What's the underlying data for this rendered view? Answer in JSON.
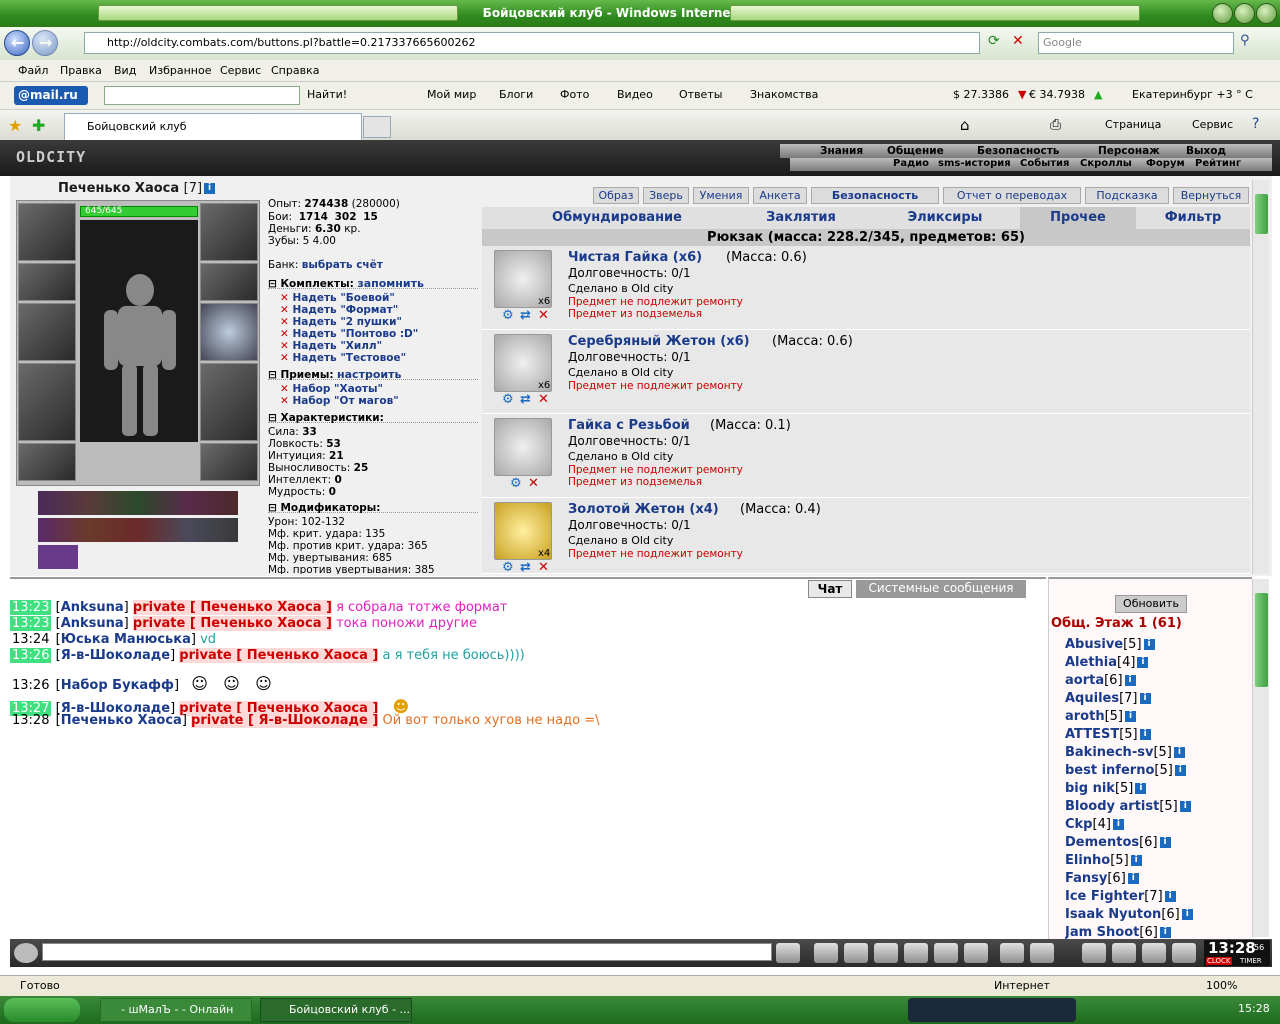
{
  "window": {
    "title": "Бойцовский клуб - Windows Internet Explorer",
    "url": "http://oldcity.combats.com/buttons.pl?battle=0.217337665600262",
    "search_placeholder": "Google"
  },
  "menu": [
    "Файл",
    "Правка",
    "Вид",
    "Избранное",
    "Сервис",
    "Справка"
  ],
  "mailbar": {
    "logo": "@mail.ru",
    "find": "Найти!",
    "links": [
      "Мой мир",
      "Блоги",
      "Фото",
      "Видео",
      "Ответы",
      "Знакомства"
    ],
    "usd": "$ 27.3386",
    "eur": "€ 34.7938",
    "weather": "Екатеринбург +3 ° C"
  },
  "tab": {
    "title": "Бойцовский клуб",
    "page": "Страница",
    "service": "Сервис"
  },
  "game_nav": {
    "logo": "OLDCITY",
    "row1": [
      "Знания",
      "Общение",
      "Безопасность",
      "Персонаж",
      "Выход"
    ],
    "row2": [
      "Радио",
      "sms-история",
      "События",
      "Скроллы",
      "Форум",
      "Рейтинг"
    ]
  },
  "character": {
    "name": "Печенько Хаоса",
    "level": "[7]",
    "hp": "645/645",
    "exp_label": "Опыт:",
    "exp": "274438",
    "exp_next": "(280000)",
    "fights_label": "Бои:",
    "fights_win": "1714",
    "fights_lose": "302",
    "fights_draw": "15",
    "money_label": "Деньги:",
    "money": "6.30",
    "money_unit": "кр.",
    "teeth_label": "Зубы:",
    "teeth": "5 4.00",
    "bank_label": "Банк:",
    "bank_link": "выбрать счёт"
  },
  "kits": {
    "title": "Комплекты:",
    "remember": "запомнить",
    "items": [
      "Надеть \"Боевой\"",
      "Надеть \"Формат\"",
      "Надеть \"2 пушки\"",
      "Надеть \"Понтово :D\"",
      "Надеть \"Хилл\"",
      "Надеть \"Тестовое\""
    ]
  },
  "techniques": {
    "title": "Приемы:",
    "setup": "настроить",
    "items": [
      "Набор \"Хаоты\"",
      "Набор \"От магов\""
    ]
  },
  "stats": {
    "title": "Характеристики:",
    "items": [
      {
        "label": "Сила:",
        "value": "33"
      },
      {
        "label": "Ловкость:",
        "value": "53"
      },
      {
        "label": "Интуиция:",
        "value": "21"
      },
      {
        "label": "Выносливость:",
        "value": "25"
      },
      {
        "label": "Интеллект:",
        "value": "0"
      },
      {
        "label": "Мудрость:",
        "value": "0"
      }
    ]
  },
  "modifiers": {
    "title": "Модификаторы:",
    "items": [
      "Урон: 102-132",
      "Мф. крит. удара: 135",
      "Мф. против крит. удара: 365",
      "Мф. увертывания: 685",
      "Мф. против увертывания: 385"
    ]
  },
  "top_tabs": [
    "Образ",
    "Зверь",
    "Умения",
    "Анкета",
    "Безопасность",
    "Отчет о переводах",
    "Подсказка",
    "Вернуться"
  ],
  "categories": [
    "Обмундирование",
    "Заклятия",
    "Эликсиры",
    "Прочее",
    "Фильтр"
  ],
  "backpack": "Рюкзак (масса: 228.2/345, предметов: 65)",
  "items": [
    {
      "name": "Чистая Гайка (x6)",
      "mass": "(Масса: 0.6)",
      "durability": "Долговечность: 0/1",
      "made": "Сделано в Old city",
      "notes": [
        "Предмет не подлежит ремонту",
        "Предмет из подземелья"
      ],
      "count": "x6"
    },
    {
      "name": "Серебряный Жетон (x6)",
      "mass": "(Масса: 0.6)",
      "durability": "Долговечность: 0/1",
      "made": "Сделано в Old city",
      "notes": [
        "Предмет не подлежит ремонту"
      ],
      "count": "x6"
    },
    {
      "name": "Гайка с Резьбой",
      "mass": "(Масса: 0.1)",
      "durability": "Долговечность: 0/1",
      "made": "Сделано в Old city",
      "notes": [
        "Предмет не подлежит ремонту",
        "Предмет из подземелья"
      ],
      "count": ""
    },
    {
      "name": "Золотой Жетон (x4)",
      "mass": "(Масса: 0.4)",
      "durability": "Долговечность: 0/1",
      "made": "Сделано в Old city",
      "notes": [
        "Предмет не подлежит ремонту"
      ],
      "count": "x4"
    }
  ],
  "chat_tabs": [
    "Чат",
    "Системные сообщения"
  ],
  "chat": [
    {
      "time": "13:23",
      "hl": true,
      "nick": "Anksuna",
      "priv": "private [ Печенько Хаоса ]",
      "msg": "я собрала тотже формат",
      "color": "pink"
    },
    {
      "time": "13:23",
      "hl": true,
      "nick": "Anksuna",
      "priv": "private [ Печенько Хаоса ]",
      "msg": "тока поножи другие",
      "color": "pink"
    },
    {
      "time": "13:24",
      "hl": false,
      "nick": "Юська Манюська",
      "priv": "",
      "msg": "vd",
      "color": "teal"
    },
    {
      "time": "13:26",
      "hl": true,
      "nick": "Я-в-Шоколаде",
      "priv": "private [ Печенько Хаоса ]",
      "msg": "а я тебя не боюсь))))",
      "color": "teal"
    },
    {
      "time": "13:26",
      "hl": false,
      "nick": "Набор Букафф",
      "priv": "",
      "msg": "",
      "color": "teal"
    },
    {
      "time": "13:27",
      "hl": true,
      "nick": "Я-в-Шоколаде",
      "priv": "private [ Печенько Хаоса ]",
      "msg": "",
      "color": "teal"
    },
    {
      "time": "13:28",
      "hl": false,
      "nick": "Печенько Хаоса",
      "priv": "private [ Я-в-Шоколаде ]",
      "msg": "Ой вот только хугов не надо =\\",
      "color": "orange"
    }
  ],
  "online": {
    "refresh": "Обновить",
    "title": "Общ. Этаж 1 (61)",
    "users": [
      {
        "n": "Abusive",
        "l": "[5]"
      },
      {
        "n": "Alethia",
        "l": "[4]"
      },
      {
        "n": "aorta",
        "l": "[6]"
      },
      {
        "n": "Aquiles",
        "l": "[7]"
      },
      {
        "n": "aroth",
        "l": "[5]"
      },
      {
        "n": "ATTEST",
        "l": "[5]"
      },
      {
        "n": "Bakinech-sv",
        "l": "[5]"
      },
      {
        "n": "best inferno",
        "l": "[5]"
      },
      {
        "n": "big nik",
        "l": "[5]"
      },
      {
        "n": "Bloody artist",
        "l": "[5]"
      },
      {
        "n": "Ckp",
        "l": "[4]"
      },
      {
        "n": "Dementos",
        "l": "[6]"
      },
      {
        "n": "Elinho",
        "l": "[5]"
      },
      {
        "n": "Fansy",
        "l": "[6]"
      },
      {
        "n": "Ice Fighter",
        "l": "[7]"
      },
      {
        "n": "Isaak Nyuton",
        "l": "[6]"
      },
      {
        "n": "Jam Shoot",
        "l": "[6]"
      }
    ]
  },
  "clock": {
    "time": "13:28",
    "sec": "56",
    "label1": "CLOCK",
    "label2": "TIMER"
  },
  "status": {
    "ready": "Готово",
    "zone": "Интернет",
    "zoom": "100%"
  },
  "taskbar": {
    "app1": "- шМалЪ - - Онлайн",
    "app2": "Бойцовский клуб - ...",
    "time": "15:28"
  },
  "colors": {
    "accent_green": "#2e8a1e",
    "link_blue": "#1a3a8a",
    "alert_red": "#cc0000"
  }
}
